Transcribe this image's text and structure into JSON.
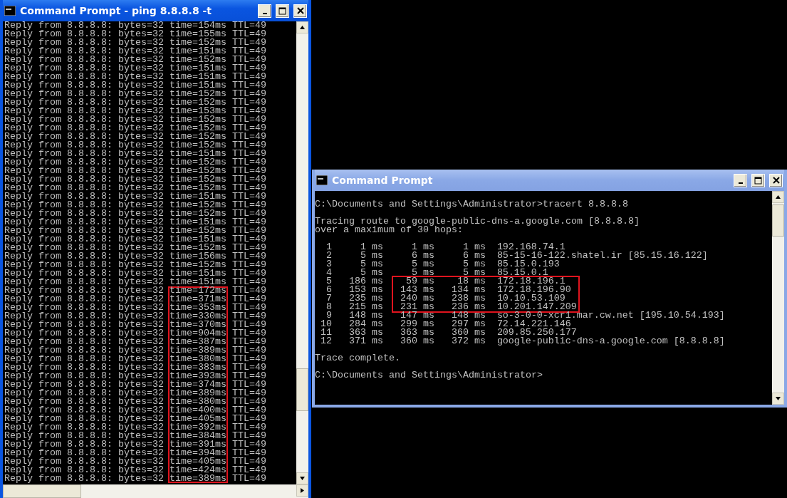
{
  "windows": [
    {
      "kind": "ping",
      "title": "Command Prompt - ping 8.8.8.8 -t",
      "active": true,
      "lines": [
        {
          "text": "Reply from 8.8.8.8: bytes=32",
          "time": "time=154ms",
          "ttl": "TTL=49",
          "marked": false
        },
        {
          "text": "Reply from 8.8.8.8: bytes=32",
          "time": "time=155ms",
          "ttl": "TTL=49",
          "marked": false
        },
        {
          "text": "Reply from 8.8.8.8: bytes=32",
          "time": "time=152ms",
          "ttl": "TTL=49",
          "marked": false
        },
        {
          "text": "Reply from 8.8.8.8: bytes=32",
          "time": "time=151ms",
          "ttl": "TTL=49",
          "marked": false
        },
        {
          "text": "Reply from 8.8.8.8: bytes=32",
          "time": "time=152ms",
          "ttl": "TTL=49",
          "marked": false
        },
        {
          "text": "Reply from 8.8.8.8: bytes=32",
          "time": "time=151ms",
          "ttl": "TTL=49",
          "marked": false
        },
        {
          "text": "Reply from 8.8.8.8: bytes=32",
          "time": "time=151ms",
          "ttl": "TTL=49",
          "marked": false
        },
        {
          "text": "Reply from 8.8.8.8: bytes=32",
          "time": "time=151ms",
          "ttl": "TTL=49",
          "marked": false
        },
        {
          "text": "Reply from 8.8.8.8: bytes=32",
          "time": "time=152ms",
          "ttl": "TTL=49",
          "marked": false
        },
        {
          "text": "Reply from 8.8.8.8: bytes=32",
          "time": "time=152ms",
          "ttl": "TTL=49",
          "marked": false
        },
        {
          "text": "Reply from 8.8.8.8: bytes=32",
          "time": "time=153ms",
          "ttl": "TTL=49",
          "marked": false
        },
        {
          "text": "Reply from 8.8.8.8: bytes=32",
          "time": "time=152ms",
          "ttl": "TTL=49",
          "marked": false
        },
        {
          "text": "Reply from 8.8.8.8: bytes=32",
          "time": "time=152ms",
          "ttl": "TTL=49",
          "marked": false
        },
        {
          "text": "Reply from 8.8.8.8: bytes=32",
          "time": "time=152ms",
          "ttl": "TTL=49",
          "marked": false
        },
        {
          "text": "Reply from 8.8.8.8: bytes=32",
          "time": "time=152ms",
          "ttl": "TTL=49",
          "marked": false
        },
        {
          "text": "Reply from 8.8.8.8: bytes=32",
          "time": "time=151ms",
          "ttl": "TTL=49",
          "marked": false
        },
        {
          "text": "Reply from 8.8.8.8: bytes=32",
          "time": "time=152ms",
          "ttl": "TTL=49",
          "marked": false
        },
        {
          "text": "Reply from 8.8.8.8: bytes=32",
          "time": "time=152ms",
          "ttl": "TTL=49",
          "marked": false
        },
        {
          "text": "Reply from 8.8.8.8: bytes=32",
          "time": "time=152ms",
          "ttl": "TTL=49",
          "marked": false
        },
        {
          "text": "Reply from 8.8.8.8: bytes=32",
          "time": "time=152ms",
          "ttl": "TTL=49",
          "marked": false
        },
        {
          "text": "Reply from 8.8.8.8: bytes=32",
          "time": "time=151ms",
          "ttl": "TTL=49",
          "marked": false
        },
        {
          "text": "Reply from 8.8.8.8: bytes=32",
          "time": "time=152ms",
          "ttl": "TTL=49",
          "marked": false
        },
        {
          "text": "Reply from 8.8.8.8: bytes=32",
          "time": "time=152ms",
          "ttl": "TTL=49",
          "marked": false
        },
        {
          "text": "Reply from 8.8.8.8: bytes=32",
          "time": "time=151ms",
          "ttl": "TTL=49",
          "marked": false
        },
        {
          "text": "Reply from 8.8.8.8: bytes=32",
          "time": "time=152ms",
          "ttl": "TTL=49",
          "marked": false
        },
        {
          "text": "Reply from 8.8.8.8: bytes=32",
          "time": "time=151ms",
          "ttl": "TTL=49",
          "marked": false
        },
        {
          "text": "Reply from 8.8.8.8: bytes=32",
          "time": "time=152ms",
          "ttl": "TTL=49",
          "marked": false
        },
        {
          "text": "Reply from 8.8.8.8: bytes=32",
          "time": "time=156ms",
          "ttl": "TTL=49",
          "marked": false
        },
        {
          "text": "Reply from 8.8.8.8: bytes=32",
          "time": "time=152ms",
          "ttl": "TTL=49",
          "marked": false
        },
        {
          "text": "Reply from 8.8.8.8: bytes=32",
          "time": "time=151ms",
          "ttl": "TTL=49",
          "marked": false
        },
        {
          "text": "Reply from 8.8.8.8: bytes=32",
          "time": "time=151ms",
          "ttl": "TTL=49",
          "marked": false
        },
        {
          "text": "Reply from 8.8.8.8: bytes=32",
          "time": "time=172ms",
          "ttl": "TTL=49",
          "marked": true
        },
        {
          "text": "Reply from 8.8.8.8: bytes=32",
          "time": "time=371ms",
          "ttl": "TTL=49",
          "marked": true
        },
        {
          "text": "Reply from 8.8.8.8: bytes=32",
          "time": "time=353ms",
          "ttl": "TTL=49",
          "marked": true
        },
        {
          "text": "Reply from 8.8.8.8: bytes=32",
          "time": "time=330ms",
          "ttl": "TTL=49",
          "marked": true
        },
        {
          "text": "Reply from 8.8.8.8: bytes=32",
          "time": "time=370ms",
          "ttl": "TTL=49",
          "marked": true
        },
        {
          "text": "Reply from 8.8.8.8: bytes=32",
          "time": "time=904ms",
          "ttl": "TTL=49",
          "marked": true
        },
        {
          "text": "Reply from 8.8.8.8: bytes=32",
          "time": "time=387ms",
          "ttl": "TTL=49",
          "marked": true
        },
        {
          "text": "Reply from 8.8.8.8: bytes=32",
          "time": "time=389ms",
          "ttl": "TTL=49",
          "marked": true
        },
        {
          "text": "Reply from 8.8.8.8: bytes=32",
          "time": "time=380ms",
          "ttl": "TTL=49",
          "marked": true
        },
        {
          "text": "Reply from 8.8.8.8: bytes=32",
          "time": "time=383ms",
          "ttl": "TTL=49",
          "marked": true
        },
        {
          "text": "Reply from 8.8.8.8: bytes=32",
          "time": "time=393ms",
          "ttl": "TTL=49",
          "marked": true
        },
        {
          "text": "Reply from 8.8.8.8: bytes=32",
          "time": "time=374ms",
          "ttl": "TTL=49",
          "marked": true
        },
        {
          "text": "Reply from 8.8.8.8: bytes=32",
          "time": "time=389ms",
          "ttl": "TTL=49",
          "marked": true
        },
        {
          "text": "Reply from 8.8.8.8: bytes=32",
          "time": "time=380ms",
          "ttl": "TTL=49",
          "marked": true
        },
        {
          "text": "Reply from 8.8.8.8: bytes=32",
          "time": "time=400ms",
          "ttl": "TTL=49",
          "marked": true
        },
        {
          "text": "Reply from 8.8.8.8: bytes=32",
          "time": "time=405ms",
          "ttl": "TTL=49",
          "marked": true
        },
        {
          "text": "Reply from 8.8.8.8: bytes=32",
          "time": "time=392ms",
          "ttl": "TTL=49",
          "marked": true
        },
        {
          "text": "Reply from 8.8.8.8: bytes=32",
          "time": "time=384ms",
          "ttl": "TTL=49",
          "marked": true
        },
        {
          "text": "Reply from 8.8.8.8: bytes=32",
          "time": "time=391ms",
          "ttl": "TTL=49",
          "marked": true
        },
        {
          "text": "Reply from 8.8.8.8: bytes=32",
          "time": "time=394ms",
          "ttl": "TTL=49",
          "marked": true
        },
        {
          "text": "Reply from 8.8.8.8: bytes=32",
          "time": "time=405ms",
          "ttl": "TTL=49",
          "marked": true
        },
        {
          "text": "Reply from 8.8.8.8: bytes=32",
          "time": "time=424ms",
          "ttl": "TTL=49",
          "marked": true
        },
        {
          "text": "Reply from 8.8.8.8: bytes=32",
          "time": "time=389ms",
          "ttl": "TTL=49",
          "marked": true
        }
      ]
    },
    {
      "kind": "tracert",
      "title": "Command Prompt",
      "active": false,
      "command": "C:\\Documents and Settings\\Administrator>tracert 8.8.8.8",
      "intro": [
        "Tracing route to google-public-dns-a.google.com [8.8.8.8]",
        "over a maximum of 30 hops:"
      ],
      "hops": [
        {
          "hop": "1",
          "t1": "1 ms",
          "t2": "1 ms",
          "t3": "1 ms",
          "host": "192.168.74.1",
          "marked": false
        },
        {
          "hop": "2",
          "t1": "5 ms",
          "t2": "6 ms",
          "t3": "6 ms",
          "host": "85-15-16-122.shatel.ir [85.15.16.122]",
          "marked": false
        },
        {
          "hop": "3",
          "t1": "5 ms",
          "t2": "5 ms",
          "t3": "5 ms",
          "host": "85.15.0.193",
          "marked": false
        },
        {
          "hop": "4",
          "t1": "5 ms",
          "t2": "5 ms",
          "t3": "5 ms",
          "host": "85.15.0.1",
          "marked": false
        },
        {
          "hop": "5",
          "t1": "186 ms",
          "t2": "59 ms",
          "t3": "18 ms",
          "host": "172.18.196.1",
          "marked": true
        },
        {
          "hop": "6",
          "t1": "153 ms",
          "t2": "143 ms",
          "t3": "134 ms",
          "host": "172.18.196.90",
          "marked": true
        },
        {
          "hop": "7",
          "t1": "235 ms",
          "t2": "240 ms",
          "t3": "238 ms",
          "host": "10.10.53.109",
          "marked": true
        },
        {
          "hop": "8",
          "t1": "215 ms",
          "t2": "231 ms",
          "t3": "236 ms",
          "host": "10.201.147.209",
          "marked": true
        },
        {
          "hop": "9",
          "t1": "148 ms",
          "t2": "147 ms",
          "t3": "148 ms",
          "host": "so-3-0-0-xcr1.mar.cw.net [195.10.54.193]",
          "marked": false
        },
        {
          "hop": "10",
          "t1": "284 ms",
          "t2": "299 ms",
          "t3": "297 ms",
          "host": "72.14.221.146",
          "marked": false
        },
        {
          "hop": "11",
          "t1": "363 ms",
          "t2": "363 ms",
          "t3": "360 ms",
          "host": "209.85.250.177",
          "marked": false
        },
        {
          "hop": "12",
          "t1": "371 ms",
          "t2": "360 ms",
          "t3": "372 ms",
          "host": "google-public-dns-a.google.com [8.8.8.8]",
          "marked": false
        }
      ],
      "complete": "Trace complete.",
      "prompt": "C:\\Documents and Settings\\Administrator>"
    }
  ]
}
